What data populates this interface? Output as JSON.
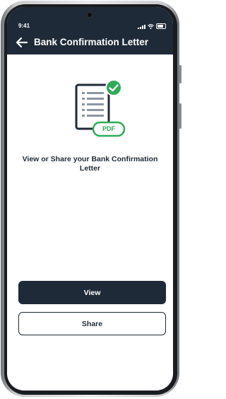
{
  "status_bar": {
    "time": "9:41"
  },
  "header": {
    "title": "Bank Confirmation Letter",
    "back_icon": "arrow-left-icon"
  },
  "illustration": {
    "badge_text": "PDF",
    "check_icon": "check-circle-icon",
    "colors": {
      "accent": "#2eab56",
      "document": "#1f2a38",
      "lines": "#8d96a3"
    }
  },
  "main": {
    "message": "View or Share your Bank Confirmation Letter"
  },
  "actions": {
    "view_label": "View",
    "share_label": "Share"
  },
  "colors": {
    "primary": "#1f2a38",
    "background": "#ffffff"
  }
}
